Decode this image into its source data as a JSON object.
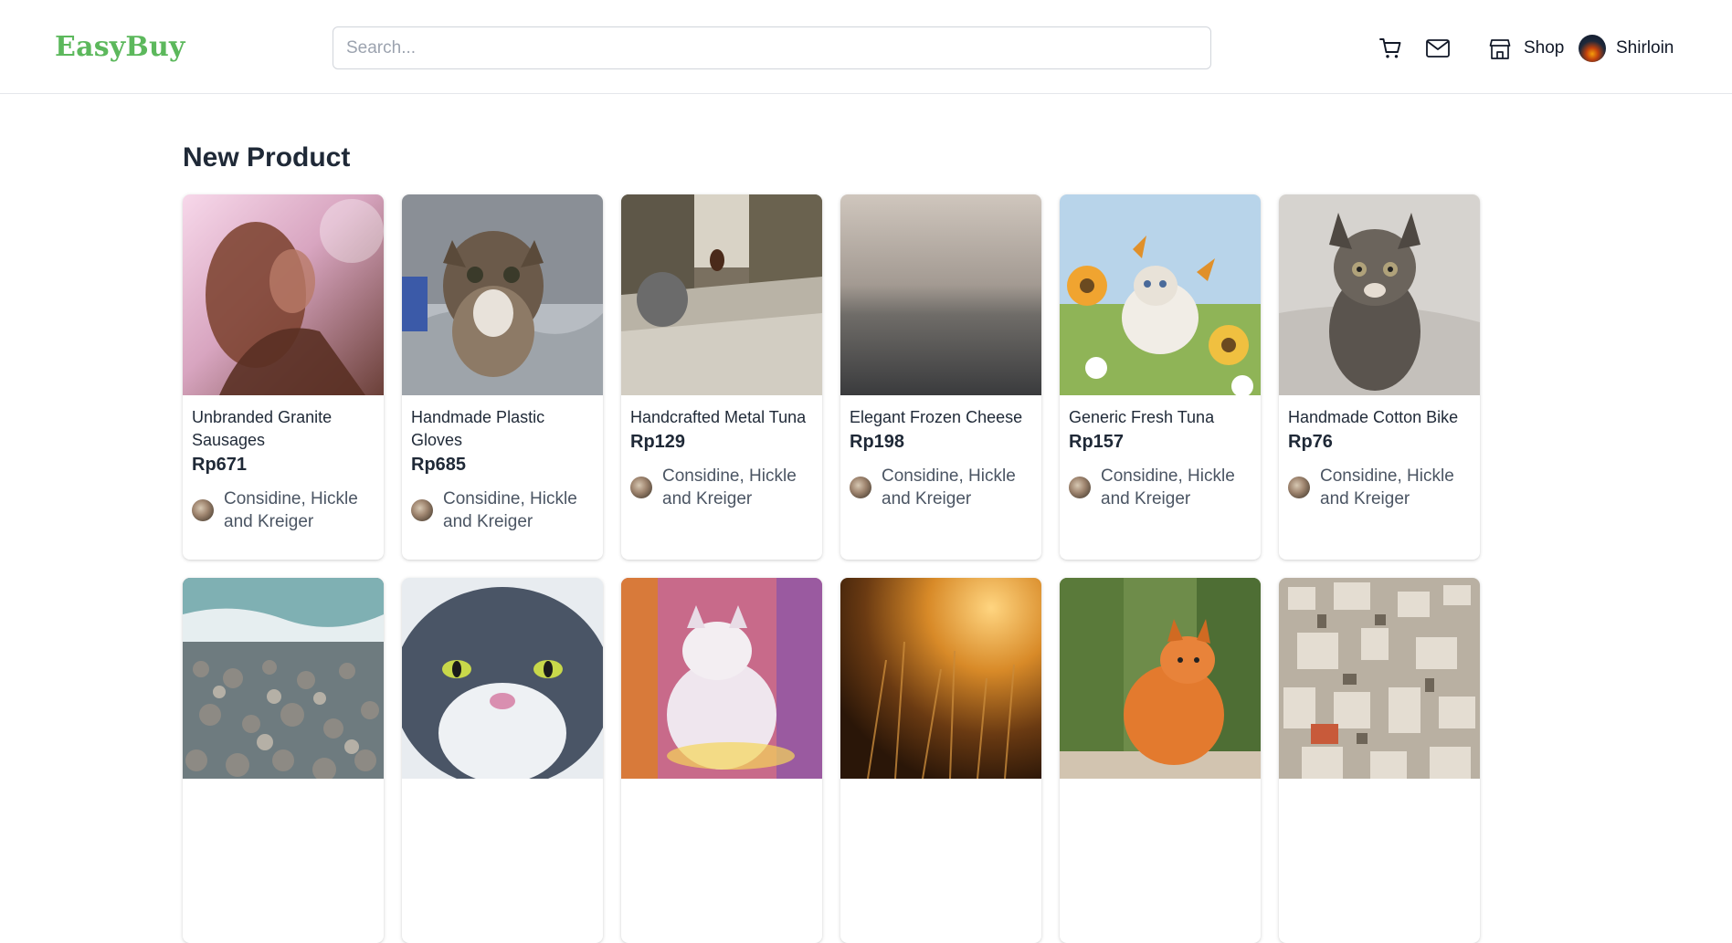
{
  "brand": {
    "logo_text": "EasyBuy",
    "accent_color": "#5cb85c"
  },
  "search": {
    "placeholder": "Search...",
    "value": ""
  },
  "nav": {
    "cart_icon": "cart-icon",
    "mail_icon": "mail-icon",
    "shop_icon": "store-icon",
    "shop_label": "Shop",
    "user_label": "Shirloin"
  },
  "section": {
    "title": "New Product"
  },
  "products": [
    {
      "name": "Unbranded Granite Sausages",
      "price": "Rp671",
      "shop": "Considine, Hickle and Kreiger",
      "image": "woman-portrait-photo"
    },
    {
      "name": "Handmade Plastic Gloves",
      "price": "Rp685",
      "shop": "Considine, Hickle and Kreiger",
      "image": "tabby-kitten-photo"
    },
    {
      "name": "Handcrafted Metal Tuna",
      "price": "Rp129",
      "shop": "Considine, Hickle and Kreiger",
      "image": "kittens-on-carpet-photo"
    },
    {
      "name": "Elegant Frozen Cheese",
      "price": "Rp198",
      "shop": "Considine, Hickle and Kreiger",
      "image": "misty-sea-photo"
    },
    {
      "name": "Generic Fresh Tuna",
      "price": "Rp157",
      "shop": "Considine, Hickle and Kreiger",
      "image": "cat-butterflies-painting"
    },
    {
      "name": "Handmade Cotton Bike",
      "price": "Rp76",
      "shop": "Considine, Hickle and Kreiger",
      "image": "tabby-kitten-bed-photo"
    },
    {
      "name": "",
      "price": "",
      "shop": "",
      "image": "pebble-beach-photo"
    },
    {
      "name": "",
      "price": "",
      "shop": "",
      "image": "grumpy-cat-watercolor"
    },
    {
      "name": "",
      "price": "",
      "shop": "",
      "image": "white-cat-watercolor"
    },
    {
      "name": "",
      "price": "",
      "shop": "",
      "image": "golden-grass-sunset-photo"
    },
    {
      "name": "",
      "price": "",
      "shop": "",
      "image": "orange-cat-watercolor"
    },
    {
      "name": "",
      "price": "",
      "shop": "",
      "image": "city-aerial-photo"
    }
  ]
}
